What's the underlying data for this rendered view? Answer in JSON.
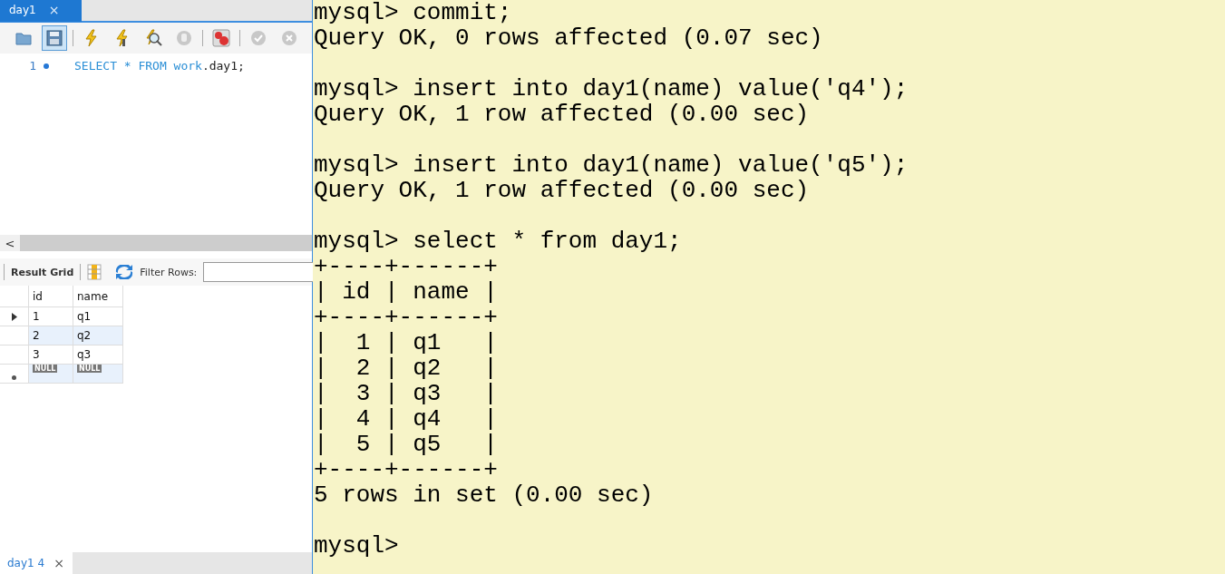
{
  "editor_tab": {
    "label": "day1",
    "close": "×"
  },
  "toolbar": [
    {
      "kind": "folder",
      "selected": false
    },
    {
      "kind": "save",
      "selected": true
    },
    {
      "kind": "bolt",
      "selected": false
    },
    {
      "kind": "bolt-cursor",
      "selected": false
    },
    {
      "kind": "bolt-search",
      "selected": false
    },
    {
      "kind": "stop",
      "selected": false
    },
    {
      "kind": "toggle",
      "selected": false
    },
    {
      "kind": "check",
      "selected": false
    },
    {
      "kind": "cancel",
      "selected": false
    }
  ],
  "editor": {
    "lines": [
      {
        "number": "1",
        "keyword1": "SELECT * FROM",
        "schema": "work",
        "rest": ".day1;"
      }
    ]
  },
  "scroll_left": "<",
  "result_toolbar": {
    "grid_label": "Result Grid",
    "filter_label": "Filter Rows:"
  },
  "grid": {
    "columns": [
      "id",
      "name"
    ],
    "rows": [
      {
        "cells": [
          "1",
          "q1"
        ],
        "current": true,
        "kind": "data"
      },
      {
        "cells": [
          "2",
          "q2"
        ],
        "current": false,
        "kind": "data"
      },
      {
        "cells": [
          "3",
          "q3"
        ],
        "current": false,
        "kind": "data"
      },
      {
        "cells": [
          "NULL",
          "NULL"
        ],
        "current": false,
        "kind": "new"
      }
    ]
  },
  "result_tab": {
    "label": "day1 4",
    "close": "×"
  },
  "terminal": {
    "blocks": [
      [
        "mysql> commit;",
        "Query OK, 0 rows affected (0.07 sec)"
      ],
      [
        "mysql> insert into day1(name) value('q4');",
        "Query OK, 1 row affected (0.00 sec)"
      ],
      [
        "mysql> insert into day1(name) value('q5');",
        "Query OK, 1 row affected (0.00 sec)"
      ],
      [
        "mysql> select * from day1;",
        "+----+------+",
        "| id | name |",
        "+----+------+",
        "|  1 | q1   |",
        "|  2 | q2   |",
        "|  3 | q3   |",
        "|  4 | q4   |",
        "|  5 | q5   |",
        "+----+------+",
        "5 rows in set (0.00 sec)"
      ],
      [
        "mysql>"
      ]
    ]
  }
}
